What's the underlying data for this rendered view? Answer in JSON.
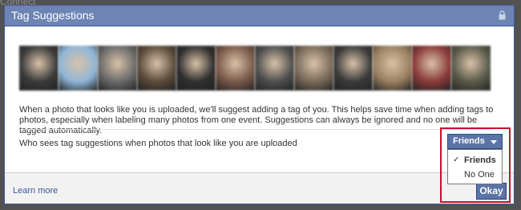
{
  "background": {
    "text": "Connect"
  },
  "dialog": {
    "title": "Tag Suggestions",
    "lock_icon": "lock-icon",
    "photos": [
      {
        "name": "photo-1",
        "color": "#3a3a3a"
      },
      {
        "name": "photo-2",
        "color": "#8fb6d8"
      },
      {
        "name": "photo-3",
        "color": "#6a6a6a"
      },
      {
        "name": "photo-4",
        "color": "#5a4a3a"
      },
      {
        "name": "photo-5",
        "color": "#2e2e2e"
      },
      {
        "name": "photo-6",
        "color": "#7a5a4a"
      },
      {
        "name": "photo-7",
        "color": "#4e4e4e"
      },
      {
        "name": "photo-8",
        "color": "#7a6a5a"
      },
      {
        "name": "photo-9",
        "color": "#3a3a3a"
      },
      {
        "name": "photo-10",
        "color": "#9a8060"
      },
      {
        "name": "photo-11",
        "color": "#8a3a3a"
      },
      {
        "name": "photo-12",
        "color": "#5a5a4a"
      }
    ],
    "description": "When a photo that looks like you is uploaded, we'll suggest adding a tag of you. This helps save time when adding tags to photos, especially when labeling many photos from one event. Suggestions can always be ignored and no one will be tagged automatically.",
    "who_sees_label": "Who sees tag suggestions when photos that look like you are uploaded",
    "privacy_button": "Friends",
    "privacy_options": [
      {
        "label": "Friends",
        "selected": true
      },
      {
        "label": "No One",
        "selected": false
      }
    ],
    "check_mark": "✓",
    "learn_more": "Learn more",
    "okay_button": "Okay"
  },
  "colors": {
    "title_bar": "#6d84b4",
    "brand_blue": "#3b5998",
    "button_blue": "#5b74a8",
    "highlight_red": "#c8102e"
  }
}
